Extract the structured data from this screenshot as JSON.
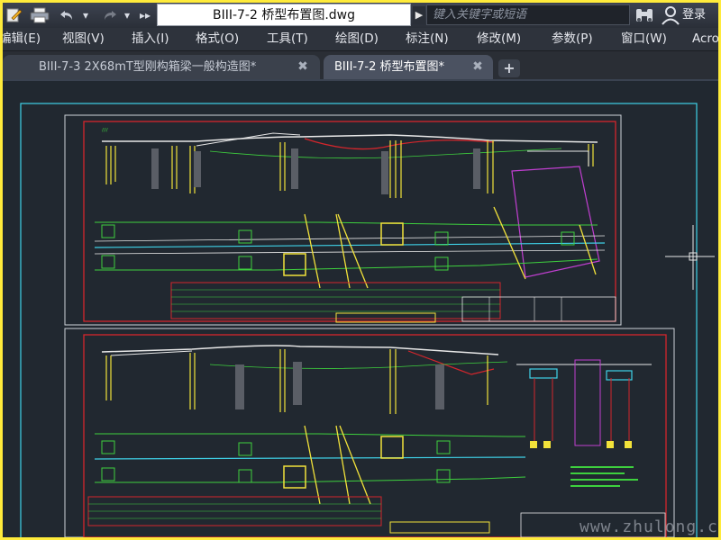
{
  "titlebar": {
    "document_title": "BIII-7-2 桥型布置图.dwg",
    "search_placeholder": "键入关键字或短语",
    "login_label": "登录"
  },
  "menu": {
    "items": [
      "编辑(E)",
      "视图(V)",
      "插入(I)",
      "格式(O)",
      "工具(T)",
      "绘图(D)",
      "标注(N)",
      "修改(M)",
      "参数(P)",
      "窗口(W)",
      "Acro"
    ]
  },
  "tabs": {
    "items": [
      {
        "label": "BIII-7-3 2X68mT型刚构箱梁一般构造图*",
        "active": false
      },
      {
        "label": "BIII-7-2 桥型布置图*",
        "active": true
      }
    ]
  },
  "canvas": {
    "watermark": "www.zhulong.com"
  },
  "colors": {
    "canvas_bg": "#212830",
    "border_frame": "#ffeb3b",
    "drawing_red": "#d4262c",
    "drawing_green": "#3ed13e",
    "drawing_yellow": "#f2e23a",
    "drawing_cyan": "#3fd2e8",
    "drawing_magenta": "#c13fd1"
  }
}
